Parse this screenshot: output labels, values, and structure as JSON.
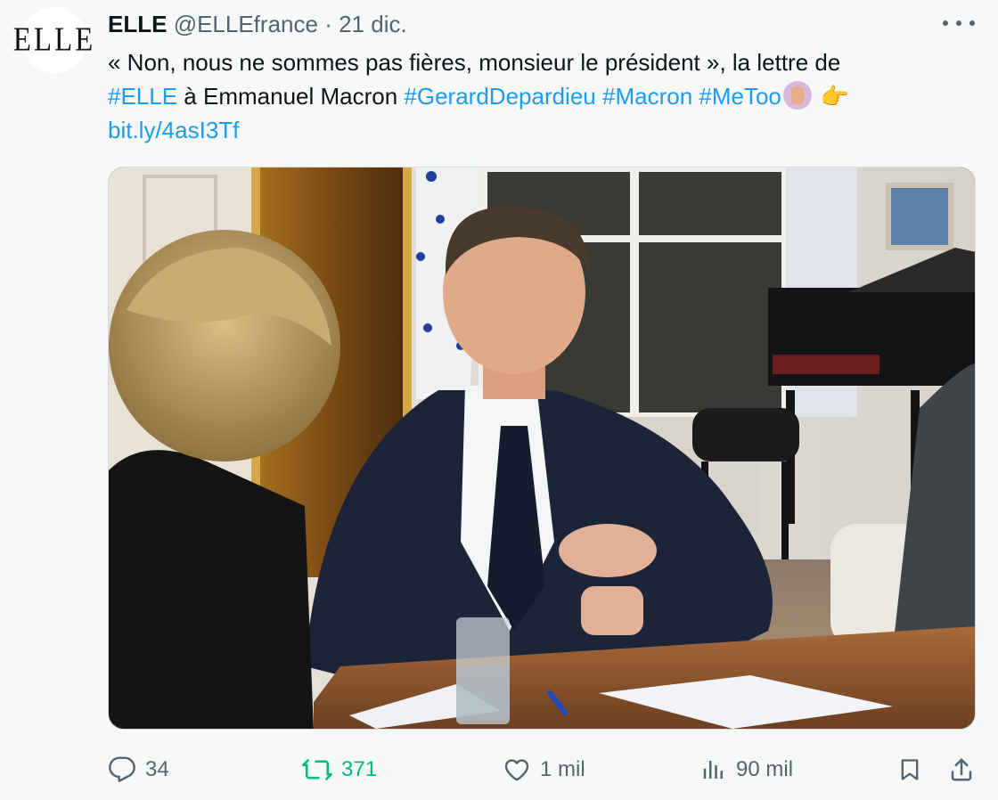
{
  "author": {
    "name": "ELLE",
    "handle": "@ELLEfrance",
    "separator": "·",
    "date": "21 dic.",
    "avatar_text": "ELLE"
  },
  "tweet": {
    "text_intro": "« Non, nous ne sommes pas fières, monsieur le président », la lettre de",
    "hashtag_elle": "#ELLE",
    "text_mid": " à Emmanuel Macron ",
    "hashtag_depardieu": "#GerardDepardieu",
    "hashtag_macron": "#Macron",
    "hashtag_metoo": "#MeToo",
    "link": "bit.ly/4asI3Tf"
  },
  "media": {
    "description_icon": "photo"
  },
  "actions": {
    "replies": "34",
    "retweets": "371",
    "likes": "1 mil",
    "views": "90 mil"
  },
  "icons": {
    "reply": "reply-icon",
    "retweet": "retweet-icon",
    "like": "heart-icon",
    "views": "views-icon",
    "bookmark": "bookmark-icon",
    "share": "share-icon",
    "more": "more-icon"
  },
  "colors": {
    "link": "#1d9bf0",
    "secondary_text": "#536471",
    "retweet_active": "#00ba7c",
    "background": "#f7f9f9"
  }
}
